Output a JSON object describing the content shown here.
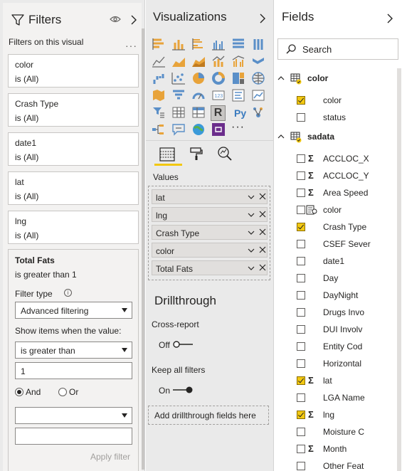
{
  "filters": {
    "title": "Filters",
    "section": "Filters on this visual",
    "more": "···",
    "cards": [
      {
        "name": "color",
        "state": "is (All)"
      },
      {
        "name": "Crash Type",
        "state": "is (All)"
      },
      {
        "name": "date1",
        "state": "is (All)"
      },
      {
        "name": "lat",
        "state": "is (All)"
      },
      {
        "name": "lng",
        "state": "is (All)"
      }
    ],
    "expanded": {
      "name": "Total Fats",
      "state": "is greater than 1",
      "filter_type_label": "Filter type",
      "filter_type_value": "Advanced filtering",
      "show_label": "Show items when the value:",
      "condition": "is greater than",
      "value": "1",
      "and_label": "And",
      "or_label": "Or",
      "second_condition": "",
      "second_value": "",
      "apply": "Apply filter"
    }
  },
  "visualizations": {
    "title": "Visualizations",
    "selected_visual": "R",
    "python_visual": "Py",
    "more": "···",
    "values_label": "Values",
    "values": [
      "lat",
      "lng",
      "Crash Type",
      "color",
      "Total Fats"
    ],
    "drillthrough_title": "Drillthrough",
    "cross_report_label": "Cross-report",
    "cross_report_state": "Off",
    "keep_filters_label": "Keep all filters",
    "keep_filters_state": "On",
    "drill_placeholder": "Add drillthrough fields here"
  },
  "fields": {
    "title": "Fields",
    "search_placeholder": "Search",
    "tables": [
      {
        "name": "color",
        "fields": [
          {
            "label": "color",
            "checked": true,
            "type": "text"
          },
          {
            "label": "status",
            "checked": false,
            "type": "text"
          }
        ]
      },
      {
        "name": "sadata",
        "fields": [
          {
            "label": "ACCLOC_X",
            "checked": false,
            "type": "sum"
          },
          {
            "label": "ACCLOC_Y",
            "checked": false,
            "type": "sum"
          },
          {
            "label": "Area Speed",
            "checked": false,
            "type": "sum"
          },
          {
            "label": "color",
            "checked": false,
            "type": "geo"
          },
          {
            "label": "Crash Type",
            "checked": true,
            "type": "text"
          },
          {
            "label": "CSEF Sever",
            "checked": false,
            "type": "text"
          },
          {
            "label": "date1",
            "checked": false,
            "type": "text"
          },
          {
            "label": "Day",
            "checked": false,
            "type": "text"
          },
          {
            "label": "DayNight",
            "checked": false,
            "type": "text"
          },
          {
            "label": "Drugs Invo",
            "checked": false,
            "type": "text"
          },
          {
            "label": "DUI Involv",
            "checked": false,
            "type": "text"
          },
          {
            "label": "Entity Cod",
            "checked": false,
            "type": "text"
          },
          {
            "label": "Horizontal",
            "checked": false,
            "type": "text"
          },
          {
            "label": "lat",
            "checked": true,
            "type": "sum"
          },
          {
            "label": "LGA Name",
            "checked": false,
            "type": "text"
          },
          {
            "label": "lng",
            "checked": true,
            "type": "sum"
          },
          {
            "label": "Moisture C",
            "checked": false,
            "type": "text"
          },
          {
            "label": "Month",
            "checked": false,
            "type": "sum"
          },
          {
            "label": "Other Feat",
            "checked": false,
            "type": "text"
          }
        ]
      }
    ]
  },
  "colors": {
    "accent": "#f2c811",
    "pane_bg": "#eaeaea",
    "report_purple": "#6b2d8c"
  }
}
